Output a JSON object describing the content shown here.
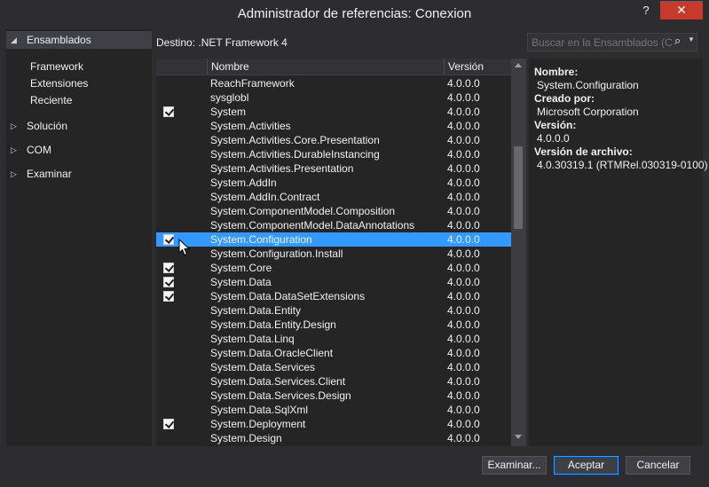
{
  "window": {
    "title": "Administrador de referencias: Conexion",
    "help_label": "?",
    "close_label": "✕"
  },
  "sidebar": {
    "root": {
      "label": "Ensamblados",
      "children": [
        "Framework",
        "Extensiones",
        "Reciente"
      ]
    },
    "nodes": [
      "Solución",
      "COM",
      "Examinar"
    ]
  },
  "destination": "Destino: .NET Framework 4",
  "search": {
    "placeholder": "Buscar en la Ensamblados (Ctrl+E)",
    "icon": "search-icon"
  },
  "table": {
    "columns": [
      "Nombre",
      "Versión"
    ],
    "rows": [
      {
        "checked": false,
        "name": "ReachFramework",
        "version": "4.0.0.0"
      },
      {
        "checked": false,
        "name": "sysglobl",
        "version": "4.0.0.0"
      },
      {
        "checked": true,
        "name": "System",
        "version": "4.0.0.0"
      },
      {
        "checked": false,
        "name": "System.Activities",
        "version": "4.0.0.0"
      },
      {
        "checked": false,
        "name": "System.Activities.Core.Presentation",
        "version": "4.0.0.0"
      },
      {
        "checked": false,
        "name": "System.Activities.DurableInstancing",
        "version": "4.0.0.0"
      },
      {
        "checked": false,
        "name": "System.Activities.Presentation",
        "version": "4.0.0.0"
      },
      {
        "checked": false,
        "name": "System.AddIn",
        "version": "4.0.0.0"
      },
      {
        "checked": false,
        "name": "System.AddIn.Contract",
        "version": "4.0.0.0"
      },
      {
        "checked": false,
        "name": "System.ComponentModel.Composition",
        "version": "4.0.0.0"
      },
      {
        "checked": false,
        "name": "System.ComponentModel.DataAnnotations",
        "version": "4.0.0.0"
      },
      {
        "checked": true,
        "name": "System.Configuration",
        "version": "4.0.0.0",
        "selected": true
      },
      {
        "checked": false,
        "name": "System.Configuration.Install",
        "version": "4.0.0.0"
      },
      {
        "checked": true,
        "name": "System.Core",
        "version": "4.0.0.0"
      },
      {
        "checked": true,
        "name": "System.Data",
        "version": "4.0.0.0"
      },
      {
        "checked": true,
        "name": "System.Data.DataSetExtensions",
        "version": "4.0.0.0"
      },
      {
        "checked": false,
        "name": "System.Data.Entity",
        "version": "4.0.0.0"
      },
      {
        "checked": false,
        "name": "System.Data.Entity.Design",
        "version": "4.0.0.0"
      },
      {
        "checked": false,
        "name": "System.Data.Linq",
        "version": "4.0.0.0"
      },
      {
        "checked": false,
        "name": "System.Data.OracleClient",
        "version": "4.0.0.0"
      },
      {
        "checked": false,
        "name": "System.Data.Services",
        "version": "4.0.0.0"
      },
      {
        "checked": false,
        "name": "System.Data.Services.Client",
        "version": "4.0.0.0"
      },
      {
        "checked": false,
        "name": "System.Data.Services.Design",
        "version": "4.0.0.0"
      },
      {
        "checked": false,
        "name": "System.Data.SqlXml",
        "version": "4.0.0.0"
      },
      {
        "checked": true,
        "name": "System.Deployment",
        "version": "4.0.0.0"
      },
      {
        "checked": false,
        "name": "System.Design",
        "version": "4.0.0.0"
      }
    ]
  },
  "details": {
    "name_label": "Nombre:",
    "name_value": "System.Configuration",
    "creator_label": "Creado por:",
    "creator_value": "Microsoft Corporation",
    "version_label": "Versión:",
    "version_value": "4.0.0.0",
    "file_version_label": "Versión de archivo:",
    "file_version_value": "4.0.30319.1 (RTMRel.030319-0100)"
  },
  "buttons": {
    "browse": "Examinar...",
    "accept": "Aceptar",
    "cancel": "Cancelar"
  },
  "colors": {
    "selection": "#3399ff",
    "close": "#c7392b",
    "background": "#2d2d30"
  }
}
